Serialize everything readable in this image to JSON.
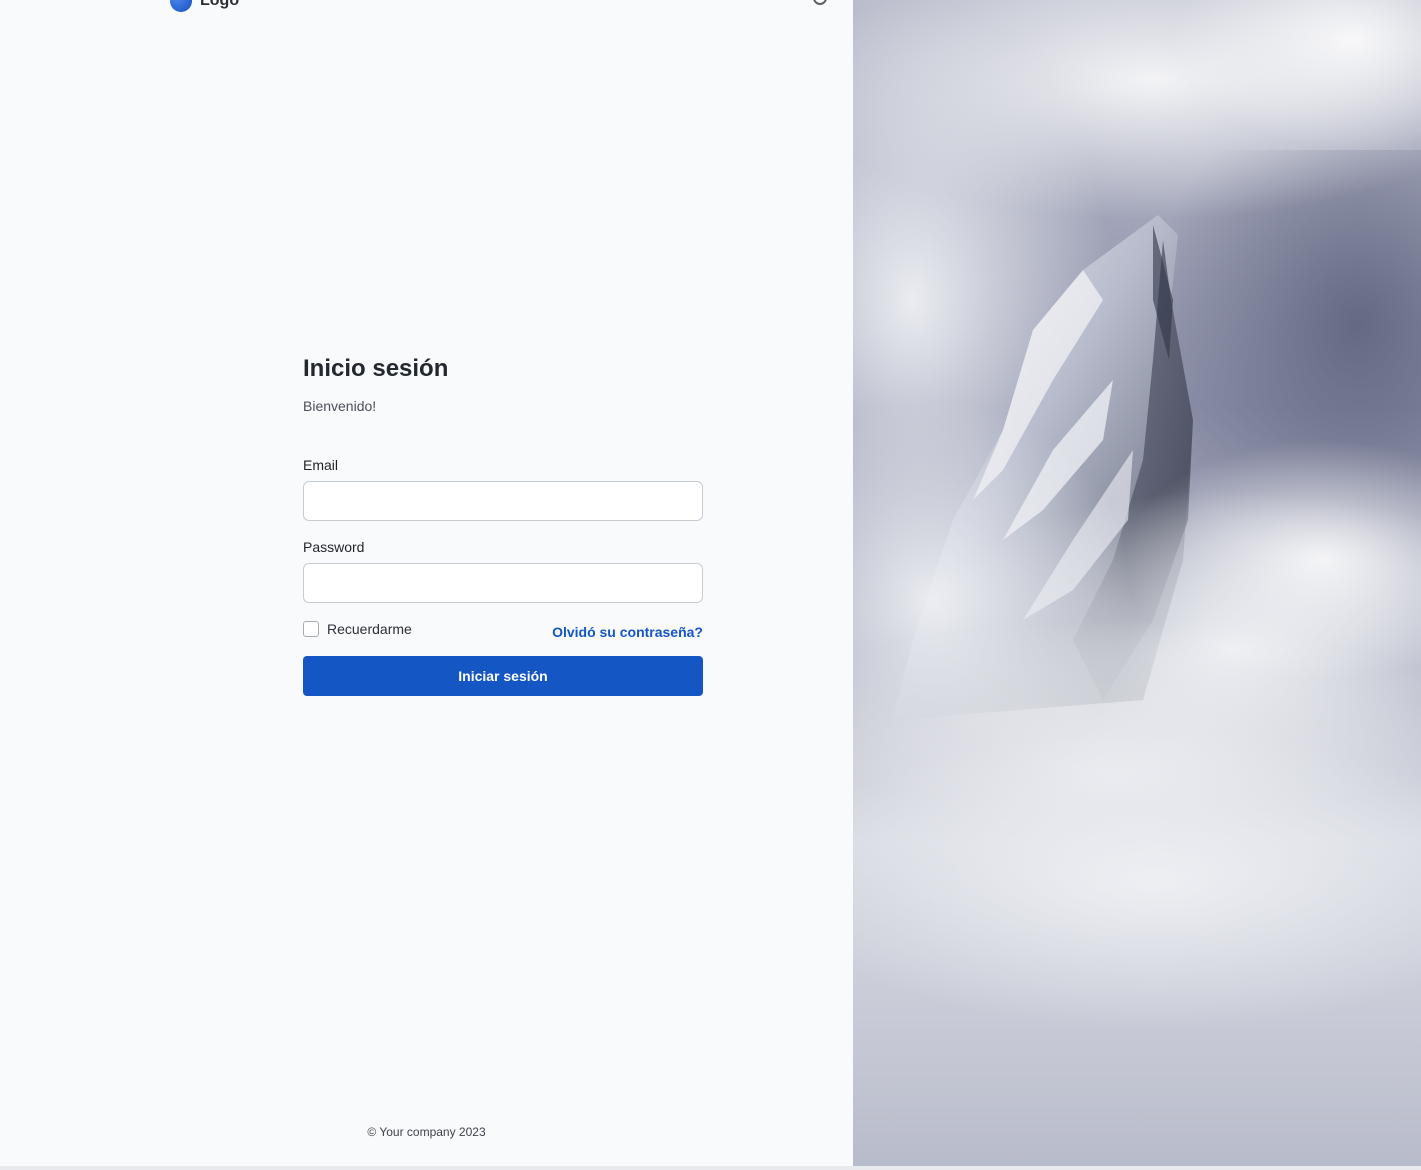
{
  "header": {
    "logo_text": "Logo",
    "logo_icon": "logo-mark",
    "top_right_icon": "circle-icon"
  },
  "login": {
    "title": "Inicio sesión",
    "subtitle": "Bienvenido!",
    "email_label": "Email",
    "email_value": "",
    "password_label": "Password",
    "password_value": "",
    "remember_label": "Recuerdarme",
    "remember_checked": false,
    "forgot_label": "Olvidó su contraseña?",
    "submit_label": "Iniciar sesión"
  },
  "footer": {
    "copyright": "© Your company 2023"
  },
  "colors": {
    "accent": "#1456c4",
    "left_background": "#f9fafc"
  },
  "image": {
    "subject": "snowy-mountain-peak-in-clouds"
  }
}
